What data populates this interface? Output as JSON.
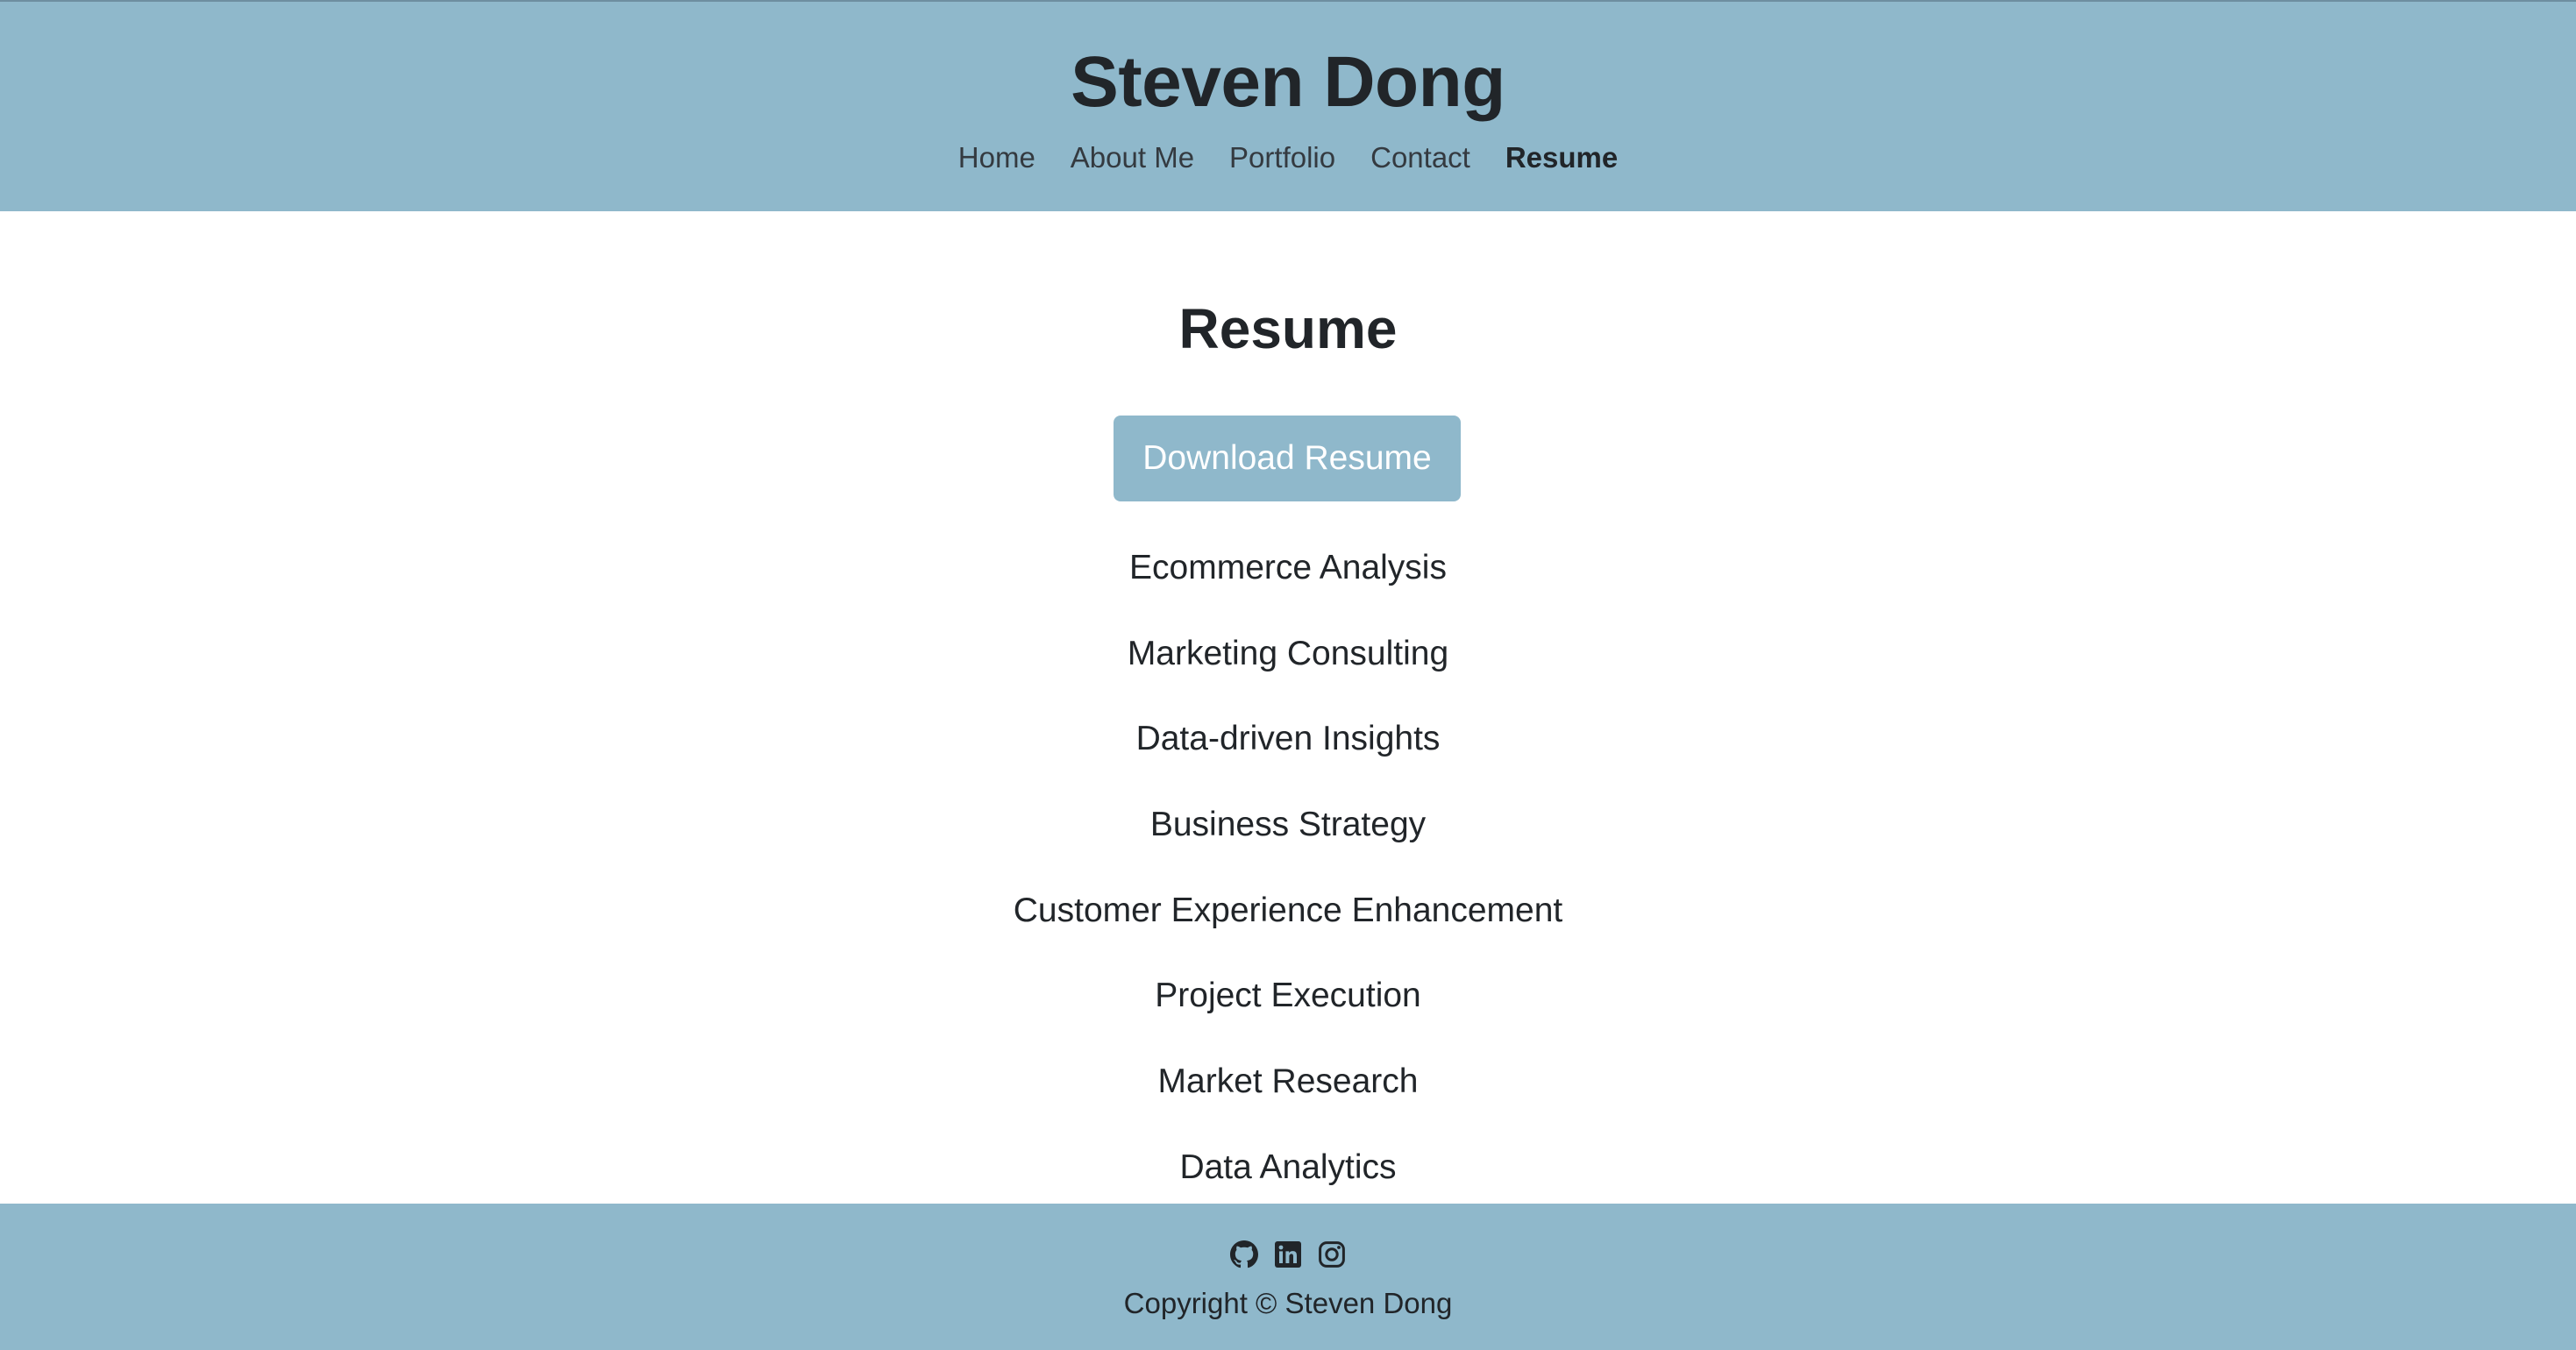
{
  "header": {
    "site_title": "Steven Dong",
    "nav": [
      {
        "label": "Home",
        "active": false
      },
      {
        "label": "About Me",
        "active": false
      },
      {
        "label": "Portfolio",
        "active": false
      },
      {
        "label": "Contact",
        "active": false
      },
      {
        "label": "Resume",
        "active": true
      }
    ]
  },
  "main": {
    "title": "Resume",
    "download_label": "Download Resume",
    "skills": [
      "Ecommerce Analysis",
      "Marketing Consulting",
      "Data-driven Insights",
      "Business Strategy",
      "Customer Experience Enhancement",
      "Project Execution",
      "Market Research",
      "Data Analytics"
    ]
  },
  "footer": {
    "icons": [
      "github-icon",
      "linkedin-icon",
      "instagram-icon"
    ],
    "copyright": "Copyright © Steven Dong"
  },
  "colors": {
    "accent": "#8fb8cb",
    "text": "#212529",
    "button_text": "#ffffff"
  }
}
